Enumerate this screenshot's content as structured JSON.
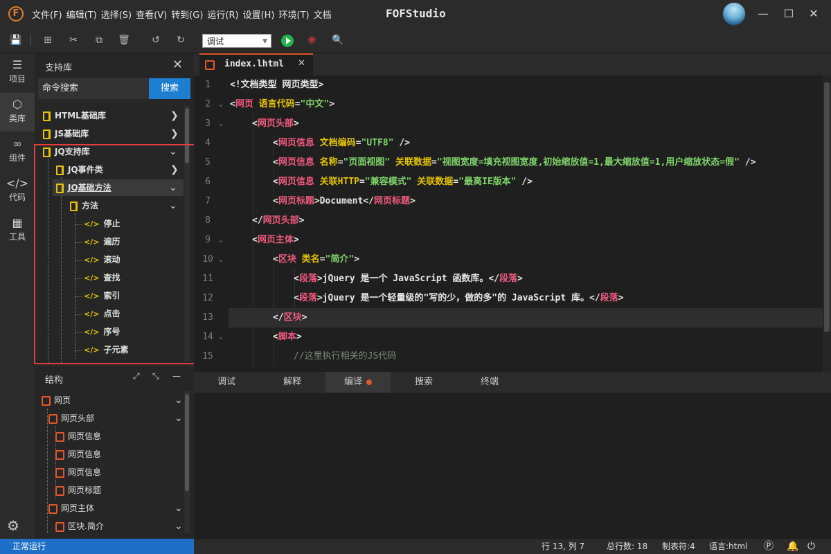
{
  "app": {
    "menu": [
      "文件(F)",
      "编辑(T)",
      "选择(S)",
      "查看(V)",
      "转到(G)",
      "运行(R)",
      "设置(H)",
      "环境(T)",
      "文档"
    ],
    "title": "FOFStudio",
    "logo_letter": "F"
  },
  "toolbar": {
    "mode_select": "调试"
  },
  "activity": [
    {
      "label": "项目",
      "icon": "layers-icon"
    },
    {
      "label": "类库",
      "icon": "cube-icon"
    },
    {
      "label": "组件",
      "icon": "infinity-icon"
    },
    {
      "label": "代码",
      "icon": "code-icon"
    },
    {
      "label": "工具",
      "icon": "grid-icon"
    }
  ],
  "library": {
    "title": "支持库",
    "search_value": "命令搜索",
    "search_button": "搜索",
    "items": [
      {
        "label": "HTML基础库"
      },
      {
        "label": "JS基础库"
      },
      {
        "label": "JQ支持库"
      },
      {
        "label": "JQ事件类"
      },
      {
        "label": "JQ基础方法"
      },
      {
        "label": "方法"
      },
      {
        "label": "停止"
      },
      {
        "label": "遍历"
      },
      {
        "label": "滚动"
      },
      {
        "label": "查找"
      },
      {
        "label": "索引"
      },
      {
        "label": "点击"
      },
      {
        "label": "序号"
      },
      {
        "label": "子元素"
      }
    ]
  },
  "structure": {
    "title": "结构",
    "items": [
      {
        "label": "网页"
      },
      {
        "label": "网页头部"
      },
      {
        "label": "网页信息"
      },
      {
        "label": "网页信息"
      },
      {
        "label": "网页信息"
      },
      {
        "label": "网页标题"
      },
      {
        "label": "网页主体"
      },
      {
        "label": "区块.简介"
      }
    ]
  },
  "editor": {
    "tab": "index.lhtml",
    "line_numbers": [
      "1",
      "2",
      "3",
      "4",
      "5",
      "6",
      "7",
      "8",
      "9",
      "10",
      "11",
      "12",
      "13",
      "14",
      "15"
    ]
  },
  "bottom_tabs": [
    "调试",
    "解释",
    "编译",
    "搜索",
    "终端"
  ],
  "status": {
    "left": "正常运行",
    "position": "行 13, 列 7",
    "total_lines": "总行数: 18",
    "tab_size": "制表符:4",
    "language": "语言:html"
  },
  "colors": {
    "accent": "#1e7fd0",
    "status_left": "#1e6fc8",
    "highlight_box": "#e23c3c",
    "tag": "#f05a7e",
    "attr": "#e6c400",
    "string": "#7fd46a"
  }
}
